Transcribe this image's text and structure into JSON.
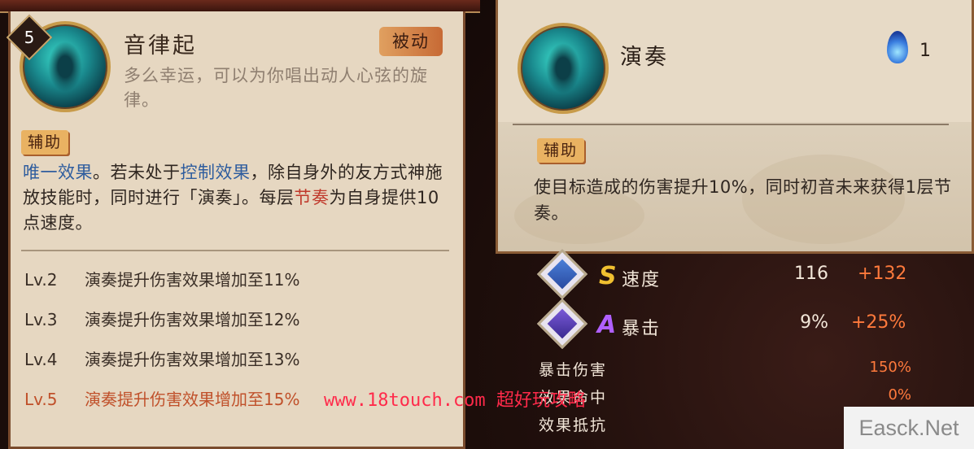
{
  "left_card": {
    "level": "5",
    "title": "音律起",
    "type_label": "被动",
    "description": "多么幸运，可以为你唱出动人心弦的旋律。",
    "tag": "辅助",
    "effect": {
      "kw1": "唯一效果",
      "t1": "。若未处于",
      "kw2": "控制效果",
      "t2": "，除自身外的友方式神施放技能时，同时进行「演奏」。每层",
      "kw3": "节奏",
      "t3": "为自身提供10点速度。"
    },
    "levels": [
      {
        "lv": "Lv.2",
        "text": "演奏提升伤害效果增加至11%"
      },
      {
        "lv": "Lv.3",
        "text": "演奏提升伤害效果增加至12%"
      },
      {
        "lv": "Lv.4",
        "text": "演奏提升伤害效果增加至13%"
      },
      {
        "lv": "Lv.5",
        "text": "演奏提升伤害效果增加至15%"
      }
    ]
  },
  "right_card": {
    "title": "演奏",
    "cost": "1",
    "tag": "辅助",
    "effect": "使目标造成的伤害提升10%，同时初音未来获得1层节奏。"
  },
  "stats": {
    "speed": {
      "grade": "S",
      "name": "速度",
      "base": "116",
      "bonus": "+132"
    },
    "crit": {
      "grade": "A",
      "name": "暴击",
      "base": "9%",
      "bonus": "+25%"
    },
    "crit_damage": {
      "name": "暴击伤害",
      "value": "150%"
    },
    "hit": {
      "name": "效果命中",
      "value": "0%"
    },
    "resist": {
      "name": "效果抵抗"
    }
  },
  "colors": {
    "accent_orange": "#ff7a3c",
    "active_level": "#c0502a",
    "keyword_blue": "#2f5d9e",
    "keyword_red": "#c0392b"
  },
  "watermark": "www.18touch.com 超好玩攻略",
  "brand": "Easck.Net"
}
